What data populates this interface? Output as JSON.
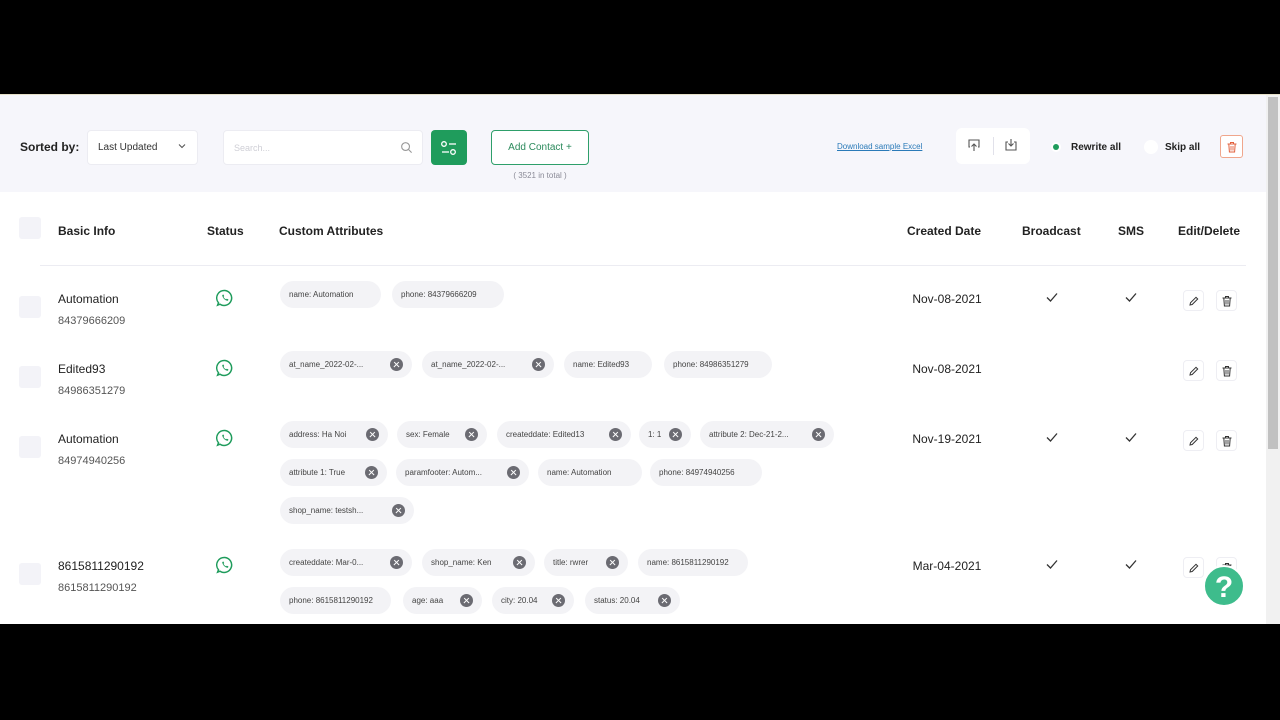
{
  "toolbar": {
    "sorted_by_label": "Sorted by:",
    "sort_value": "Last Updated",
    "search_placeholder": "Search...",
    "add_contact_label": "Add Contact +",
    "total_text": "( 3521 in total )",
    "download_label": "Download sample Excel",
    "rewrite_label": "Rewrite all",
    "skip_label": "Skip all"
  },
  "table": {
    "headers": {
      "basic_info": "Basic Info",
      "status": "Status",
      "custom_attributes": "Custom Attributes",
      "created_date": "Created Date",
      "broadcast": "Broadcast",
      "sms": "SMS",
      "edit_delete": "Edit/Delete"
    },
    "rows": [
      {
        "name": "Automation",
        "phone": "84379666209",
        "status_icon": "whatsapp-icon",
        "attributes": [
          "name: Automation",
          "phone: 84379666209"
        ],
        "created": "Nov-08-2021",
        "broadcast": true,
        "sms": true
      },
      {
        "name": "Edited93",
        "phone": "84986351279",
        "status_icon": "whatsapp-icon",
        "attributes": [
          "at_name_2022-02-...",
          "at_name_2022-02-...",
          "name: Edited93",
          "phone: 84986351279"
        ],
        "created": "Nov-08-2021",
        "broadcast": false,
        "sms": false
      },
      {
        "name": "Automation",
        "phone": "84974940256",
        "status_icon": "whatsapp-icon",
        "attributes": [
          "address: Ha Noi",
          "sex: Female",
          "createddate: Edited13",
          "1: 1",
          "attribute 2: Dec-21-2...",
          "attribute 1: True",
          "paramfooter: Autom...",
          "name: Automation",
          "phone: 84974940256",
          "shop_name: testsh..."
        ],
        "created": "Nov-19-2021",
        "broadcast": true,
        "sms": true
      },
      {
        "name": "8615811290192",
        "phone": "8615811290192",
        "status_icon": "whatsapp-icon",
        "attributes": [
          "createddate: Mar-0...",
          "shop_name: Ken",
          "title: rwrer",
          "name: 8615811290192",
          "phone: 8615811290192",
          "age: aaa",
          "city: 20.04",
          "status: 20.04"
        ],
        "created": "Mar-04-2021",
        "broadcast": true,
        "sms": true
      }
    ]
  },
  "colors": {
    "accent": "#1f9c5c",
    "help": "#3ebc8c"
  },
  "help_glyph": "?"
}
